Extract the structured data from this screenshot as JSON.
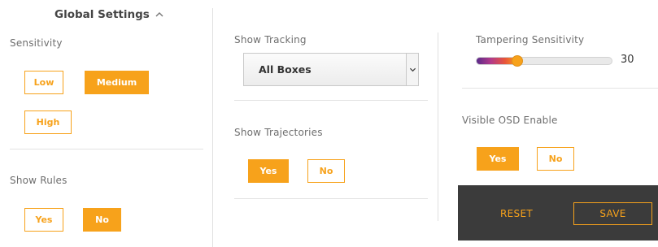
{
  "header": {
    "title": "Global Settings"
  },
  "sensitivity": {
    "label": "Sensitivity",
    "options": [
      "Low",
      "Medium",
      "High"
    ],
    "selected": "Medium"
  },
  "show_rules": {
    "label": "Show Rules",
    "options": [
      "Yes",
      "No"
    ],
    "selected": "No"
  },
  "show_tracking": {
    "label": "Show Tracking",
    "value": "All Boxes"
  },
  "show_trajectories": {
    "label": "Show Trajectories",
    "options": [
      "Yes",
      "No"
    ],
    "selected": "Yes"
  },
  "tampering": {
    "label": "Tampering Sensitivity",
    "value": "30",
    "level_fraction": 0.3
  },
  "visible_osd": {
    "label": "Visible OSD Enable",
    "options": [
      "Yes",
      "No"
    ],
    "selected": "Yes"
  },
  "footer": {
    "reset_label": "RESET",
    "save_label": "SAVE"
  },
  "colors": {
    "accent": "#f7a21b",
    "footer_bg": "#3b3b3b"
  },
  "icons": {
    "header_toggle": "chevron-up-icon",
    "select_arrow": "chevron-down-icon"
  }
}
